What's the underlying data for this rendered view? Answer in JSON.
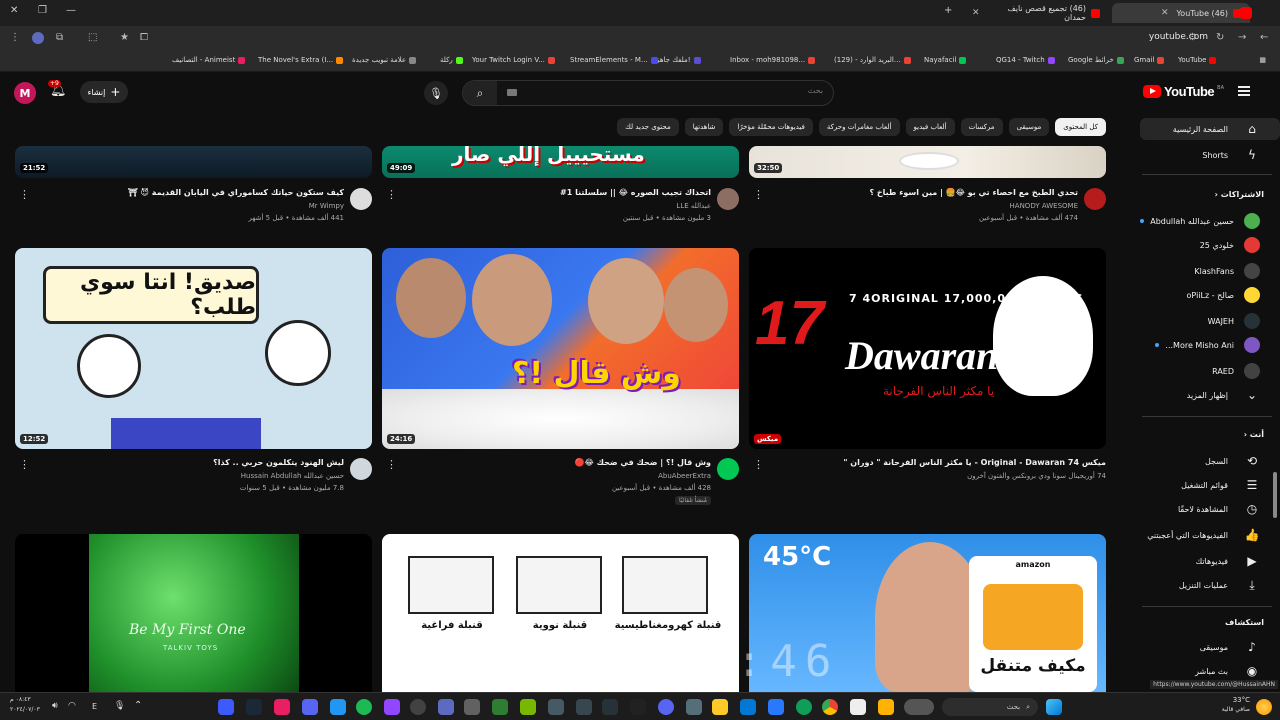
{
  "browser": {
    "tabs": [
      {
        "title": "(46) YouTube",
        "active": true
      },
      {
        "title": "(46) تجميع قصص نايف حمدان",
        "active": false
      }
    ],
    "url": "youtube.com",
    "bookmarks": [
      {
        "label": "YouTube",
        "color": "#ff0000"
      },
      {
        "label": "Gmail",
        "color": "#ea4335"
      },
      {
        "label": "Google خرائط",
        "color": "#34a853"
      },
      {
        "label": "QG14 - Twitch",
        "color": "#9146ff"
      },
      {
        "label": "Nayafacil",
        "color": "#00c853"
      },
      {
        "label": "البريد الوارد - (129)...",
        "color": "#ea4335"
      },
      {
        "label": "Inbox - moh981098...",
        "color": "#ea4335"
      },
      {
        "label": "ملفك جاهز!",
        "color": "#5a4fcf"
      },
      {
        "label": "StreamElements - M...",
        "color": "#4a4af0"
      },
      {
        "label": "Your Twitch Login V...",
        "color": "#ea4335"
      },
      {
        "label": "ركلة",
        "color": "#53fc18"
      },
      {
        "label": "علامة تبويب جديدة",
        "color": "#888888"
      },
      {
        "label": "The Novel's Extra (I...",
        "color": "#ff8a00"
      },
      {
        "label": "التصانيف - Animeist",
        "color": "#e91e63"
      }
    ]
  },
  "header": {
    "avatar_letter": "M",
    "bell_badge": "+9",
    "create_label": "إنشاء",
    "search_placeholder": "بحث",
    "logo_text": "YouTube",
    "logo_region": "BA"
  },
  "chips": [
    {
      "label": "كل المحتوى",
      "active": true
    },
    {
      "label": "موسيقى",
      "active": false
    },
    {
      "label": "مركسات",
      "active": false
    },
    {
      "label": "ألعاب فيديو",
      "active": false
    },
    {
      "label": "ألعاب مغامرات وحركة",
      "active": false
    },
    {
      "label": "فيديوهات محمّلة مؤخرًا",
      "active": false
    },
    {
      "label": "شاهدتها",
      "active": false
    },
    {
      "label": "محتوى جديد لك",
      "active": false
    }
  ],
  "sidebar": {
    "home": "الصفحة الرئيسية",
    "shorts": "Shorts",
    "subs_heading": "الاشتراكات",
    "subscriptions": [
      {
        "label": "حسين عبدالله Abdullah",
        "color": "#4caf50",
        "dot": true
      },
      {
        "label": "خلودي 25",
        "color": "#e53935",
        "dot": false
      },
      {
        "label": "KlashFans",
        "color": "#444444",
        "dot": false
      },
      {
        "label": "صالح - oPiiLz",
        "color": "#fdd835",
        "dot": false
      },
      {
        "label": "WAJEH",
        "color": "#263238",
        "dot": false
      },
      {
        "label": "More Misho Ani...",
        "color": "#7e57c2",
        "dot": true
      },
      {
        "label": "RAED",
        "color": "#424242",
        "dot": false
      }
    ],
    "show_more": "إظهار المزيد",
    "you_heading": "أنت",
    "you_items": [
      {
        "label": "السجل",
        "icon": "history-icon",
        "glyph": "⟲"
      },
      {
        "label": "قوائم التشغيل",
        "icon": "playlist-icon",
        "glyph": "☰"
      },
      {
        "label": "المشاهدة لاحقًا",
        "icon": "clock-icon",
        "glyph": "◷"
      },
      {
        "label": "الفيديوهات التي أعجبتني",
        "icon": "like-icon",
        "glyph": "👍"
      },
      {
        "label": "فيديوهاتك",
        "icon": "video-icon",
        "glyph": "▶"
      },
      {
        "label": "عمليات التنزيل",
        "icon": "download-icon",
        "glyph": "⤓"
      }
    ],
    "explore_heading": "استكشاف",
    "explore_items": [
      {
        "label": "موسيقى",
        "icon": "music-icon",
        "glyph": "♪"
      },
      {
        "label": "بث مباشر",
        "icon": "live-icon",
        "glyph": "◉"
      }
    ]
  },
  "videos_row1": [
    {
      "duration": "21:52",
      "title": "كيف ستكون حياتك كساموراي في اليابان القديمة 😈 ⛩",
      "channel": "Mr Wimpy",
      "stats": "441 ألف مشاهدة • قبل 5 أشهر",
      "avatar": "#dddddd"
    },
    {
      "duration": "49:09",
      "title": "اتحداك تجيب الصوره 😂 || سلسلتنا 1#",
      "channel": "عبدالله LLE",
      "stats": "3 مليون مشاهدة • قبل سنتين",
      "avatar": "#8d6e63"
    },
    {
      "duration": "32:50",
      "title": "تحدي الطبخ مع احصاء تي بو 😂🍔 | مين اسوء طباخ ؟",
      "channel": "HANODY AWESOME",
      "stats": "474 ألف مشاهدة • قبل أسبوعين",
      "avatar": "#b71c1c"
    }
  ],
  "videos_row2": [
    {
      "duration": "12:52",
      "title": "ليش الهنود يتكلمون حربي .. كذا؟",
      "channel": "حسين عبدالله Hussain Abdullah",
      "stats": "7.8 مليون مشاهدة • قبل 5 سنوات",
      "avatar": "#cfd8dc",
      "thumb_text": "صديق! انتا سوي طلب؟",
      "tag": ""
    },
    {
      "duration": "24:16",
      "title": "وش قال !؟ | ضحك في ضحك 😂🔴",
      "channel": "AbuAbeerExtra",
      "stats": "428 ألف مشاهدة • قبل أسبوعين",
      "avatar": "#00c853",
      "thumb_text": "وش قال !؟",
      "tag": "مُنشأ تلقائيًا"
    },
    {
      "duration": "ميكس",
      "title": "ميكس Original - Dawaran 74 - يا مكثر الناس الفرحانة \" دوران \"",
      "channel": "74 أوريجينال سونا ودي برونكس والفتون آخرون",
      "stats": "",
      "avatar": "",
      "thumb_text": "Dawaran",
      "thumb_views": "7 4ORIGINAL 17,000,000+ VIEWS",
      "thumb_sub": "يا مكثر الناس الفرحانة",
      "tag": ""
    }
  ],
  "videos_row3": [
    {
      "thumb_text": "Be My First One",
      "thumb_sub": "TALKIV TOYS"
    },
    {
      "labels": [
        "قنبلة فراغية",
        "قنبلة نووية",
        "قنبلة كهرومغناطيسية"
      ]
    },
    {
      "temp": "45°C",
      "brand": "amazon",
      "product": "مكيف متنقل"
    }
  ],
  "overlay_clock": "03:14:15:46",
  "status_url": "https://www.youtube.com/@HussainAHN",
  "taskbar": {
    "weather_temp": "33°C",
    "weather_desc": "صافي قالية",
    "search_label": "بحث",
    "time": "٠٨:٤٣ م",
    "date": "٢٠٢٤/٠٧/٠٣"
  }
}
